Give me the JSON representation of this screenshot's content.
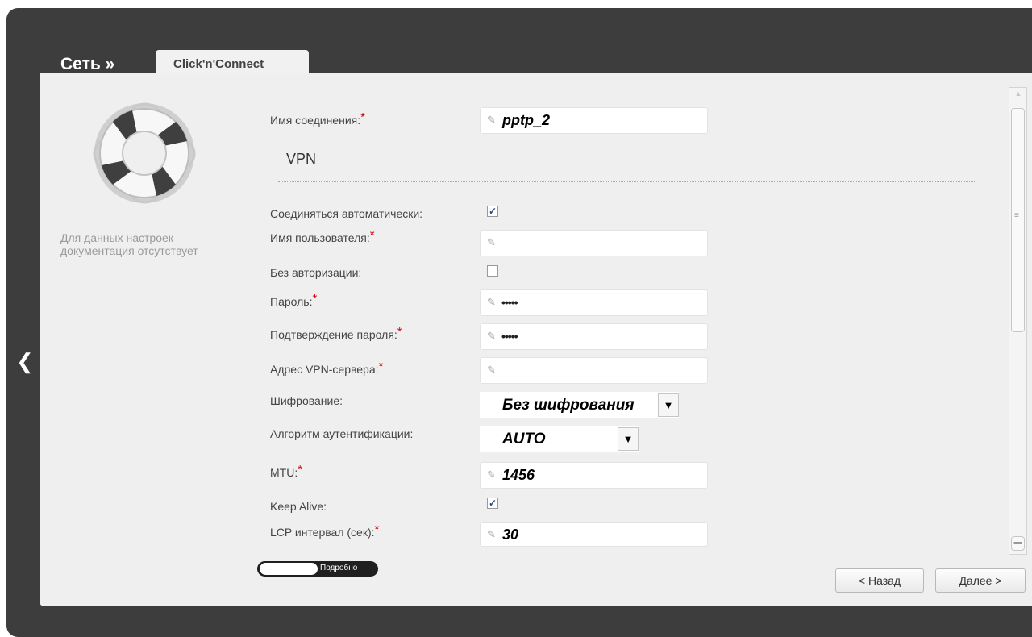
{
  "header": {
    "breadcrumb": "Сеть »",
    "tab_label": "Click'n'Connect"
  },
  "sidebar": {
    "doc_note": "Для данных настроек документация отсутствует",
    "back_icon": "chevron-left-icon",
    "help_icon": "lifebuoy-icon"
  },
  "form": {
    "connection_name": {
      "label": "Имя соединения:",
      "required": "*",
      "value": "pptp_2"
    },
    "section_vpn": "VPN",
    "auto_connect": {
      "label": "Соединяться автоматически:",
      "checked": true
    },
    "username": {
      "label": "Имя пользователя:",
      "required": "*",
      "value": ""
    },
    "no_auth": {
      "label": "Без авторизации:",
      "checked": false
    },
    "password": {
      "label": "Пароль:",
      "required": "*",
      "value": "•••••"
    },
    "password_confirm": {
      "label": "Подтверждение пароля:",
      "required": "*",
      "value": "•••••"
    },
    "vpn_server": {
      "label": "Адрес VPN-сервера:",
      "required": "*",
      "value": ""
    },
    "encryption": {
      "label": "Шифрование:",
      "selected": "Без шифрования"
    },
    "auth_algorithm": {
      "label": "Алгоритм аутентификации:",
      "selected": "AUTO"
    },
    "mtu": {
      "label": "MTU:",
      "required": "*",
      "value": "1456"
    },
    "keep_alive": {
      "label": "Keep Alive:",
      "checked": true
    },
    "lcp_interval": {
      "label": "LCP интервал (сек):",
      "required": "*",
      "value": "30"
    }
  },
  "footer": {
    "details_toggle": "Подробно",
    "back_button": "< Назад",
    "next_button": "Далее >"
  },
  "colors": {
    "frame": "#3d3d3d",
    "panel": "#efefef",
    "required": "#d60000"
  }
}
